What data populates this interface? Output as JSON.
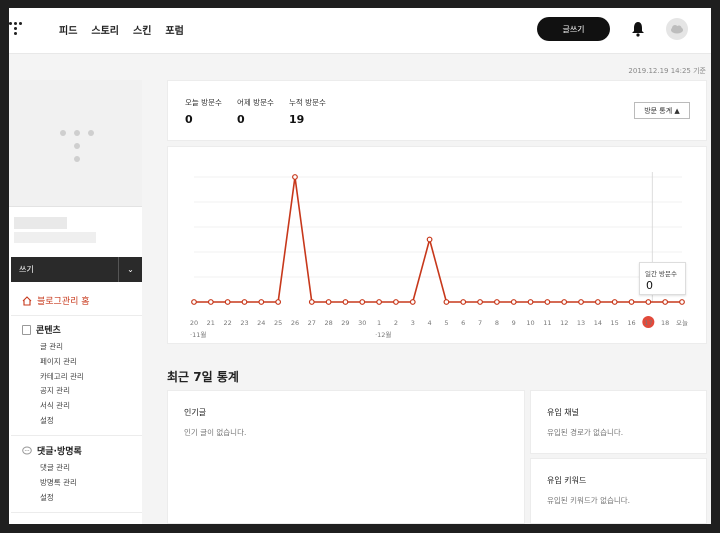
{
  "nav": {
    "items": [
      "피드",
      "스토리",
      "스킨",
      "포럼"
    ],
    "write_button": "글쓰기"
  },
  "timestamp": "2019.12.19 14:25 기준",
  "sidebar": {
    "write_label": "쓰기",
    "home_label": "블로그관리 홈",
    "sections": [
      {
        "title": "콘텐츠",
        "links": [
          "글 관리",
          "페이지 관리",
          "카테고리 관리",
          "공지 관리",
          "서식 관리",
          "설정"
        ]
      },
      {
        "title": "댓글·방명록",
        "links": [
          "댓글 관리",
          "방명록 관리",
          "설정"
        ]
      }
    ]
  },
  "stats": {
    "today_label": "오늘 방문수",
    "today_value": "0",
    "yesterday_label": "어제 방문수",
    "yesterday_value": "0",
    "total_label": "누적 방문수",
    "total_value": "19",
    "button_label": "방문 통계"
  },
  "chart_data": {
    "type": "line",
    "x": [
      "20",
      "21",
      "22",
      "23",
      "24",
      "25",
      "26",
      "27",
      "28",
      "29",
      "30",
      "1",
      "2",
      "3",
      "4",
      "5",
      "6",
      "7",
      "8",
      "9",
      "10",
      "11",
      "12",
      "13",
      "14",
      "15",
      "16",
      "17",
      "18",
      "오늘"
    ],
    "month_labels": [
      {
        "at": "20",
        "text": "11월"
      },
      {
        "at": "1",
        "text": "12월"
      }
    ],
    "series": [
      {
        "values": [
          0,
          0,
          0,
          0,
          0,
          0,
          6,
          0,
          0,
          0,
          0,
          0,
          0,
          0,
          3,
          0,
          0,
          0,
          0,
          0,
          0,
          0,
          0,
          0,
          0,
          0,
          0,
          0,
          0,
          0
        ]
      }
    ],
    "highlight_x": "17",
    "tooltip_label": "일간 방문수",
    "tooltip_value": "0",
    "colors": {
      "line": "#c7381b",
      "highlight": "#e14a3b"
    }
  },
  "recent": {
    "title": "최근 7일 통계",
    "popular_title": "인기글",
    "popular_empty": "인기 글이 없습니다.",
    "channel_title": "유입 채널",
    "channel_empty": "유입된 경로가 없습니다.",
    "keyword_title": "유입 키워드",
    "keyword_empty": "유입된 키워드가 없습니다."
  }
}
